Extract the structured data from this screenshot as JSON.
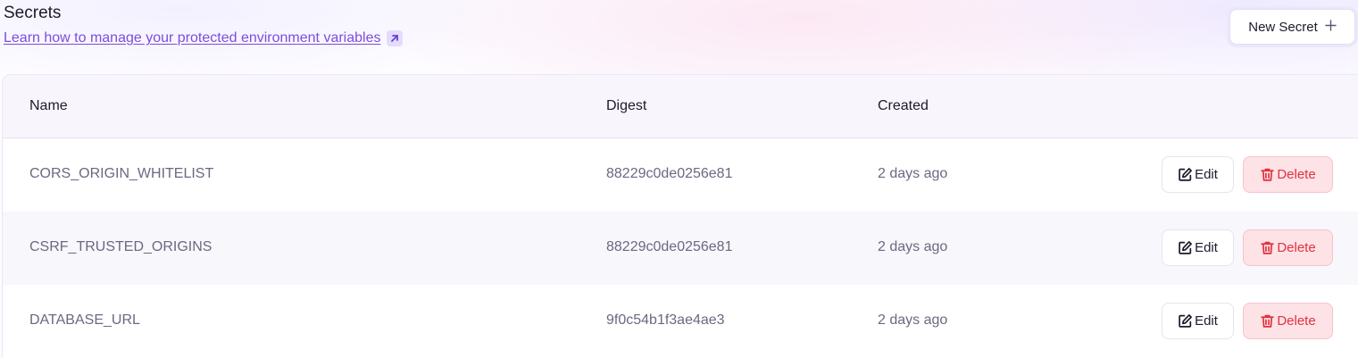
{
  "header": {
    "title": "Secrets",
    "learn_link": "Learn how to manage your protected environment variables",
    "new_secret_label": "New Secret"
  },
  "table": {
    "columns": {
      "name": "Name",
      "digest": "Digest",
      "created": "Created"
    },
    "rows": [
      {
        "name": "CORS_ORIGIN_WHITELIST",
        "digest": "88229c0de0256e81",
        "created": "2 days ago"
      },
      {
        "name": "CSRF_TRUSTED_ORIGINS",
        "digest": "88229c0de0256e81",
        "created": "2 days ago"
      },
      {
        "name": "DATABASE_URL",
        "digest": "9f0c54b1f3ae4ae3",
        "created": "2 days ago"
      }
    ],
    "actions": {
      "edit": "Edit",
      "delete": "Delete"
    }
  },
  "icons": {
    "external_link": "arrow-up-right-icon",
    "add": "plus-icon",
    "edit": "edit-icon",
    "delete": "trash-icon"
  },
  "colors": {
    "accent": "#7c4ddb",
    "danger": "#e0323f",
    "danger_bg": "#fde2e6"
  }
}
